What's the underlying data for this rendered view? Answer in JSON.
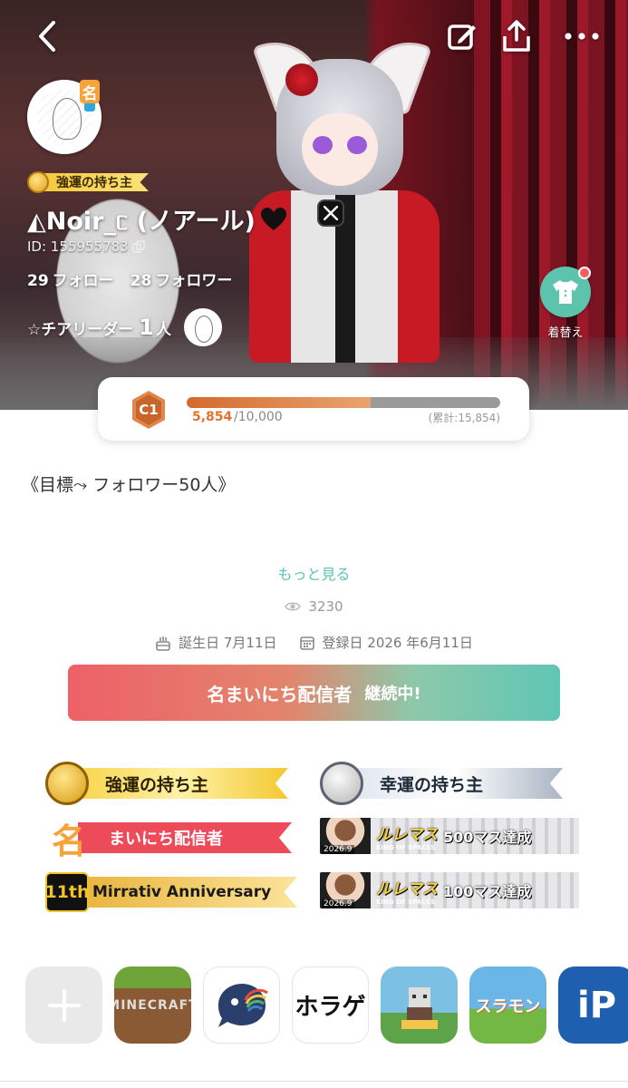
{
  "profile": {
    "username": "◭Noir_ᥴ (ノアール)",
    "user_id": "ID: 155955783",
    "title_badge": "強運の持ち主",
    "mei_glyph": "名",
    "following_count": "29",
    "following_label": "フォロー",
    "followers_count": "28",
    "followers_label": "フォロワー",
    "cheer_label": "☆チアリーダー",
    "cheer_count": "1",
    "cheer_unit": "人",
    "dress_up_label": "着替え"
  },
  "level": {
    "badge": "C1",
    "current": "5,854",
    "total": "/10,000",
    "cumulative": "(累計:15,854)",
    "progress_fraction": 0.5854
  },
  "about": {
    "goal": "《目標⤳ フォロワー50人》",
    "more_link": "もっと見る",
    "views": "3230",
    "birthday": "誕生日 7月11日",
    "registered": "登録日 2026 年6月11日"
  },
  "streak_banner": {
    "title": "名まいにち配信者",
    "status": "継続中!"
  },
  "badges": {
    "strong_luck": "強運の持ち主",
    "luck": "幸運の持ち主",
    "daily_streamer": "まいにち配信者",
    "daily_emblem": "名",
    "anniversary_emblem": "11th",
    "anniversary": "Mirrativ Anniversary",
    "rurumas_logo": "ルレマス",
    "rurumas_sub": "KING OF SPACES",
    "rurumas_500": "500マス達成",
    "rurumas_100": "100マス達成",
    "event_year": "2026.9"
  },
  "apps": {
    "minecraft": "MINECRAFT",
    "horror": "ホラゲ",
    "slime": "スラモン",
    "ip": "iP"
  },
  "colors": {
    "accent_teal": "#5ec3b4",
    "progress_orange": "#e0742f",
    "banner_red": "#ee6067",
    "banner_teal": "#5fc6b4"
  },
  "icons": {
    "nav": [
      "back-icon",
      "edit-icon",
      "share-icon",
      "more-icon"
    ],
    "social": "x-icon",
    "dress_up": "shirt-icon"
  }
}
